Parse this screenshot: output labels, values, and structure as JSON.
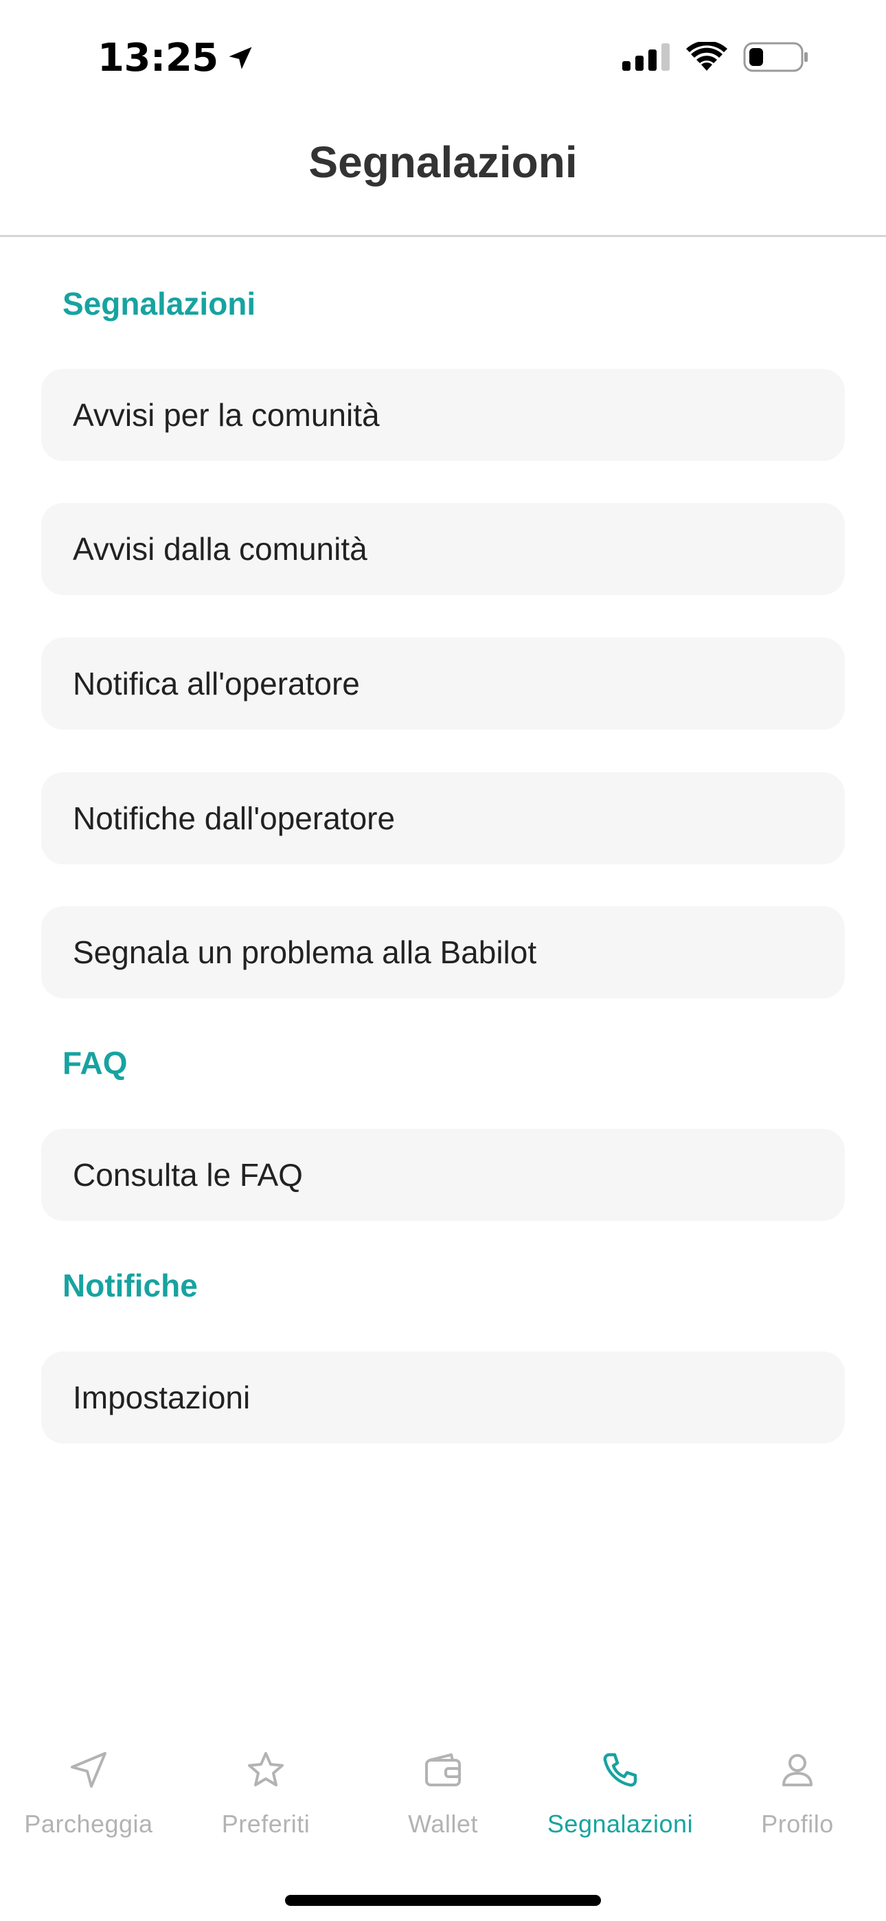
{
  "status_bar": {
    "time": "13:25"
  },
  "header": {
    "title": "Segnalazioni"
  },
  "sections": [
    {
      "title": "Segnalazioni",
      "items": [
        "Avvisi per la comunità",
        "Avvisi dalla comunità",
        "Notifica all'operatore",
        "Notifiche dall'operatore",
        "Segnala un problema alla Babilot"
      ]
    },
    {
      "title": "FAQ",
      "items": [
        "Consulta le FAQ"
      ]
    },
    {
      "title": "Notifiche",
      "items": [
        "Impostazioni"
      ]
    }
  ],
  "tab_bar": {
    "tabs": [
      {
        "label": "Parcheggia",
        "icon": "navigation-arrow-icon"
      },
      {
        "label": "Preferiti",
        "icon": "star-icon"
      },
      {
        "label": "Wallet",
        "icon": "wallet-icon"
      },
      {
        "label": "Segnalazioni",
        "icon": "phone-icon",
        "active": true
      },
      {
        "label": "Profilo",
        "icon": "user-icon"
      }
    ]
  },
  "colors": {
    "accent": "#17a3a0",
    "inactive": "#b3b3b3",
    "item_background": "#f6f6f6"
  }
}
